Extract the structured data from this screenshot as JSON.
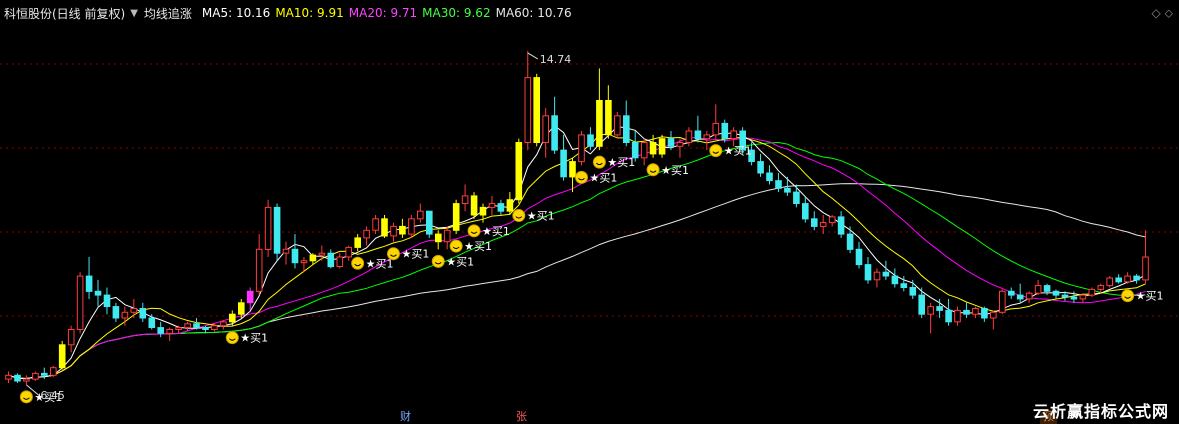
{
  "header": {
    "title": "科恒股份(日线 前复权)",
    "indicator_name": "均线追涨",
    "ma5": "MA5: 10.16",
    "ma10": "MA10: 9.91",
    "ma20": "MA20: 9.71",
    "ma30": "MA30: 9.62",
    "ma60": "MA60: 10.76"
  },
  "colors": {
    "background": "#000000",
    "up": "#ff3c3c",
    "down": "#40e8f0",
    "signal_bar": "#ffff00",
    "ma5": "#ffffff",
    "ma10": "#ffff00",
    "ma20": "#ff00ff",
    "ma30": "#00ff00",
    "ma60": "#e6e6e6",
    "grid": "#8b0000"
  },
  "badges": {
    "cai": "财",
    "zhang": "张",
    "yu": "预"
  },
  "watermark": "云析赢指标公式网",
  "chart_data": {
    "type": "candlestick",
    "high_label": "14.74",
    "low_label": "6.45",
    "ylim": [
      6.0,
      15.8
    ],
    "grid": true,
    "signal_label": "买1",
    "candles": [
      [
        6.6,
        6.8,
        6.5,
        6.7
      ],
      [
        6.7,
        6.75,
        6.5,
        6.55
      ],
      [
        6.55,
        6.7,
        6.45,
        6.6
      ],
      [
        6.6,
        6.8,
        6.55,
        6.75
      ],
      [
        6.75,
        6.9,
        6.6,
        6.7
      ],
      [
        6.7,
        6.95,
        6.65,
        6.9
      ],
      [
        6.9,
        7.6,
        6.85,
        7.5
      ],
      [
        7.5,
        8.0,
        7.3,
        7.9
      ],
      [
        7.9,
        9.4,
        7.8,
        9.3
      ],
      [
        9.3,
        9.8,
        8.7,
        8.9
      ],
      [
        8.9,
        9.2,
        8.5,
        8.8
      ],
      [
        8.8,
        9.0,
        8.3,
        8.5
      ],
      [
        8.5,
        8.6,
        8.1,
        8.2
      ],
      [
        8.2,
        8.5,
        8.0,
        8.35
      ],
      [
        8.35,
        8.7,
        8.2,
        8.45
      ],
      [
        8.45,
        8.6,
        8.1,
        8.2
      ],
      [
        8.2,
        8.3,
        7.9,
        7.95
      ],
      [
        7.95,
        8.1,
        7.7,
        7.8
      ],
      [
        7.8,
        7.95,
        7.6,
        7.9
      ],
      [
        7.9,
        8.0,
        7.8,
        7.95
      ],
      [
        7.95,
        8.1,
        7.85,
        8.05
      ],
      [
        8.05,
        8.2,
        7.9,
        7.95
      ],
      [
        7.95,
        8.0,
        7.8,
        7.9
      ],
      [
        7.9,
        8.05,
        7.85,
        8.0
      ],
      [
        8.0,
        8.15,
        7.9,
        8.1
      ],
      [
        8.1,
        8.4,
        8.0,
        8.3
      ],
      [
        8.3,
        8.7,
        8.2,
        8.6
      ],
      [
        8.6,
        9.0,
        8.4,
        8.9
      ],
      [
        8.9,
        10.4,
        8.8,
        10.0
      ],
      [
        10.0,
        11.3,
        9.8,
        11.1
      ],
      [
        11.1,
        11.2,
        9.7,
        9.9
      ],
      [
        9.9,
        10.2,
        9.6,
        10.0
      ],
      [
        10.0,
        10.4,
        9.5,
        9.65
      ],
      [
        9.65,
        9.8,
        9.4,
        9.7
      ],
      [
        9.7,
        9.9,
        9.6,
        9.85
      ],
      [
        9.85,
        10.1,
        9.7,
        9.9
      ],
      [
        9.9,
        10.0,
        9.5,
        9.55
      ],
      [
        9.55,
        9.9,
        9.5,
        9.8
      ],
      [
        9.8,
        10.1,
        9.7,
        10.05
      ],
      [
        10.05,
        10.4,
        9.95,
        10.3
      ],
      [
        10.3,
        10.6,
        10.1,
        10.5
      ],
      [
        10.5,
        10.9,
        10.4,
        10.8
      ],
      [
        10.8,
        10.9,
        10.3,
        10.35
      ],
      [
        10.35,
        10.7,
        10.2,
        10.6
      ],
      [
        10.6,
        10.8,
        10.3,
        10.4
      ],
      [
        10.4,
        10.9,
        10.3,
        10.8
      ],
      [
        10.8,
        11.2,
        10.7,
        11.0
      ],
      [
        11.0,
        10.9,
        10.3,
        10.4
      ],
      [
        10.4,
        10.5,
        10.0,
        10.2
      ],
      [
        10.2,
        10.6,
        10.0,
        10.5
      ],
      [
        10.5,
        11.3,
        10.4,
        11.2
      ],
      [
        11.2,
        11.7,
        11.0,
        11.4
      ],
      [
        11.4,
        11.5,
        10.8,
        10.9
      ],
      [
        10.9,
        11.2,
        10.7,
        11.1
      ],
      [
        11.1,
        11.4,
        10.9,
        11.2
      ],
      [
        11.2,
        11.3,
        10.9,
        11.0
      ],
      [
        11.0,
        11.5,
        10.9,
        11.3
      ],
      [
        11.3,
        12.9,
        11.2,
        12.8
      ],
      [
        12.8,
        15.2,
        12.6,
        14.5
      ],
      [
        14.5,
        14.6,
        12.7,
        12.8
      ],
      [
        12.8,
        13.7,
        12.4,
        13.5
      ],
      [
        13.5,
        14.0,
        12.5,
        12.6
      ],
      [
        12.6,
        13.0,
        11.8,
        11.9
      ],
      [
        11.9,
        12.4,
        11.5,
        12.3
      ],
      [
        12.3,
        13.1,
        12.2,
        13.0
      ],
      [
        13.0,
        13.2,
        12.6,
        12.7
      ],
      [
        12.7,
        14.74,
        12.6,
        13.9
      ],
      [
        13.9,
        14.3,
        12.9,
        13.0
      ],
      [
        13.0,
        13.6,
        12.9,
        13.5
      ],
      [
        13.5,
        13.9,
        12.7,
        12.8
      ],
      [
        12.8,
        13.1,
        12.3,
        12.4
      ],
      [
        12.4,
        12.9,
        12.2,
        12.8
      ],
      [
        12.8,
        13.0,
        12.4,
        12.5
      ],
      [
        12.5,
        13.0,
        12.4,
        12.9
      ],
      [
        12.9,
        13.1,
        12.6,
        12.7
      ],
      [
        12.7,
        12.9,
        12.4,
        12.8
      ],
      [
        12.8,
        13.2,
        12.7,
        13.1
      ],
      [
        13.1,
        13.5,
        12.8,
        12.9
      ],
      [
        12.9,
        13.1,
        12.6,
        13.0
      ],
      [
        13.0,
        13.8,
        12.9,
        13.3
      ],
      [
        13.3,
        13.4,
        12.8,
        12.9
      ],
      [
        12.9,
        13.2,
        12.7,
        13.1
      ],
      [
        13.1,
        13.2,
        12.5,
        12.6
      ],
      [
        12.6,
        12.8,
        12.2,
        12.3
      ],
      [
        12.3,
        12.5,
        11.9,
        12.0
      ],
      [
        12.0,
        12.2,
        11.7,
        11.8
      ],
      [
        11.8,
        12.0,
        11.5,
        11.6
      ],
      [
        11.6,
        11.9,
        11.4,
        11.5
      ],
      [
        11.5,
        11.7,
        11.1,
        11.2
      ],
      [
        11.2,
        11.4,
        10.7,
        10.8
      ],
      [
        10.8,
        11.0,
        10.5,
        10.6
      ],
      [
        10.6,
        10.9,
        10.4,
        10.7
      ],
      [
        10.7,
        10.9,
        10.6,
        10.85
      ],
      [
        10.85,
        11.0,
        10.3,
        10.4
      ],
      [
        10.4,
        10.6,
        9.9,
        10.0
      ],
      [
        10.0,
        10.2,
        9.5,
        9.6
      ],
      [
        9.6,
        9.8,
        9.1,
        9.2
      ],
      [
        9.2,
        9.5,
        9.0,
        9.4
      ],
      [
        9.4,
        9.7,
        9.2,
        9.3
      ],
      [
        9.3,
        9.5,
        9.0,
        9.1
      ],
      [
        9.1,
        9.3,
        8.9,
        9.0
      ],
      [
        9.0,
        9.2,
        8.7,
        8.8
      ],
      [
        8.8,
        9.0,
        8.2,
        8.3
      ],
      [
        8.3,
        8.6,
        7.8,
        8.5
      ],
      [
        8.5,
        8.7,
        8.2,
        8.4
      ],
      [
        8.4,
        8.7,
        8.0,
        8.1
      ],
      [
        8.1,
        8.5,
        8.0,
        8.4
      ],
      [
        8.4,
        8.6,
        8.2,
        8.3
      ],
      [
        8.3,
        8.5,
        8.2,
        8.45
      ],
      [
        8.45,
        8.5,
        8.1,
        8.2
      ],
      [
        8.2,
        8.4,
        7.9,
        8.35
      ],
      [
        8.35,
        8.95,
        8.3,
        8.9
      ],
      [
        8.9,
        9.0,
        8.7,
        8.8
      ],
      [
        8.8,
        9.1,
        8.6,
        8.7
      ],
      [
        8.7,
        8.9,
        8.6,
        8.85
      ],
      [
        8.85,
        9.2,
        8.8,
        9.05
      ],
      [
        9.05,
        9.1,
        8.8,
        8.9
      ],
      [
        8.9,
        8.95,
        8.7,
        8.8
      ],
      [
        8.8,
        8.9,
        8.65,
        8.75
      ],
      [
        8.75,
        8.9,
        8.6,
        8.7
      ],
      [
        8.7,
        8.85,
        8.6,
        8.8
      ],
      [
        8.8,
        9.0,
        8.75,
        8.95
      ],
      [
        8.95,
        9.1,
        8.85,
        9.05
      ],
      [
        9.05,
        9.3,
        9.0,
        9.25
      ],
      [
        9.25,
        9.35,
        9.1,
        9.15
      ],
      [
        9.15,
        9.4,
        9.1,
        9.3
      ],
      [
        9.3,
        9.35,
        9.1,
        9.2
      ],
      [
        9.2,
        10.5,
        9.1,
        9.8
      ]
    ],
    "signal_bars": [
      6,
      25,
      26,
      34,
      39,
      42,
      44,
      48,
      50,
      52,
      53,
      56,
      57,
      59,
      63,
      66,
      67,
      72,
      73
    ],
    "magenta_bars": [
      27
    ],
    "buy_signals": [
      2,
      25,
      39,
      43,
      48,
      50,
      52,
      57,
      64,
      66,
      72,
      79,
      125
    ]
  }
}
